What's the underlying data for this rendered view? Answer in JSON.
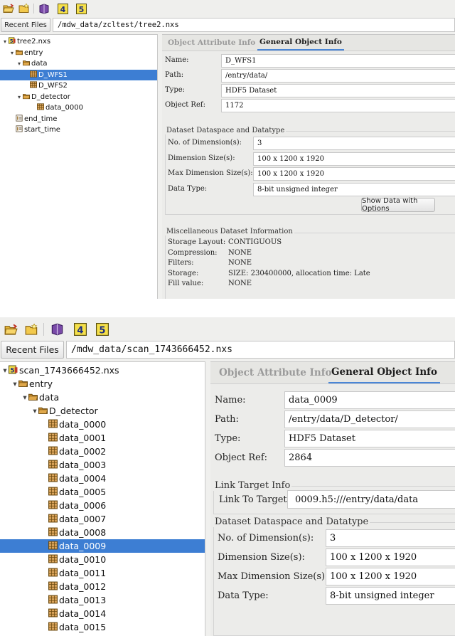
{
  "top": {
    "recent_files_label": "Recent Files",
    "path": "/mdw_data/zcltest/tree2.nxs",
    "tree": [
      {
        "label": "tree2.nxs",
        "level": 0,
        "kind": "file",
        "open": true
      },
      {
        "label": "entry",
        "level": 1,
        "kind": "group",
        "open": true
      },
      {
        "label": "data",
        "level": 2,
        "kind": "group",
        "open": true
      },
      {
        "label": "D_WFS1",
        "level": 3,
        "kind": "dataset",
        "selected": true
      },
      {
        "label": "D_WFS2",
        "level": 3,
        "kind": "dataset"
      },
      {
        "label": "D_detector",
        "level": 2,
        "kind": "group",
        "open": true
      },
      {
        "label": "data_0000",
        "level": 4,
        "kind": "dataset"
      },
      {
        "label": "end_time",
        "level": 1,
        "kind": "scalar"
      },
      {
        "label": "start_time",
        "level": 1,
        "kind": "scalar"
      }
    ],
    "tabs": [
      "Object Attribute Info",
      "General Object Info"
    ],
    "fields": [
      {
        "label": "Name:",
        "value": "D_WFS1"
      },
      {
        "label": "Path:",
        "value": "/entry/data/"
      },
      {
        "label": "Type:",
        "value": "HDF5 Dataset"
      },
      {
        "label": "Object Ref:",
        "value": "1172"
      }
    ],
    "dataspace_title": "Dataset Dataspace and Datatype",
    "dataspace": [
      {
        "label": "No. of Dimension(s):",
        "value": "3"
      },
      {
        "label": "Dimension Size(s):",
        "value": "100 x 1200 x 1920"
      },
      {
        "label": "Max Dimension Size(s):",
        "value": "100 x 1200 x 1920"
      },
      {
        "label": "Data Type:",
        "value": "8-bit unsigned integer"
      }
    ],
    "show_data_button": "Show Data with Options",
    "misc_title": "Miscellaneous Dataset Information",
    "misc": [
      {
        "label": "Storage Layout:",
        "value": "CONTIGUOUS"
      },
      {
        "label": "Compression:",
        "value": "NONE"
      },
      {
        "label": "Filters:",
        "value": "NONE"
      },
      {
        "label": "Storage:",
        "value": "SIZE: 230400000, allocation time: Late"
      },
      {
        "label": "Fill value:",
        "value": "NONE"
      }
    ]
  },
  "bottom": {
    "recent_files_label": "Recent Files",
    "path": "/mdw_data/scan_1743666452.nxs",
    "tree": [
      {
        "label": "scan_1743666452.nxs",
        "level": 0,
        "kind": "file",
        "open": true
      },
      {
        "label": "entry",
        "level": 1,
        "kind": "group",
        "open": true
      },
      {
        "label": "data",
        "level": 2,
        "kind": "group",
        "open": true
      },
      {
        "label": "D_detector",
        "level": 3,
        "kind": "group",
        "open": true
      },
      {
        "label": "data_0000",
        "level": 4,
        "kind": "dataset"
      },
      {
        "label": "data_0001",
        "level": 4,
        "kind": "dataset"
      },
      {
        "label": "data_0002",
        "level": 4,
        "kind": "dataset"
      },
      {
        "label": "data_0003",
        "level": 4,
        "kind": "dataset"
      },
      {
        "label": "data_0004",
        "level": 4,
        "kind": "dataset"
      },
      {
        "label": "data_0005",
        "level": 4,
        "kind": "dataset"
      },
      {
        "label": "data_0006",
        "level": 4,
        "kind": "dataset"
      },
      {
        "label": "data_0007",
        "level": 4,
        "kind": "dataset"
      },
      {
        "label": "data_0008",
        "level": 4,
        "kind": "dataset"
      },
      {
        "label": "data_0009",
        "level": 4,
        "kind": "dataset",
        "selected": true
      },
      {
        "label": "data_0010",
        "level": 4,
        "kind": "dataset"
      },
      {
        "label": "data_0011",
        "level": 4,
        "kind": "dataset"
      },
      {
        "label": "data_0012",
        "level": 4,
        "kind": "dataset"
      },
      {
        "label": "data_0013",
        "level": 4,
        "kind": "dataset"
      },
      {
        "label": "data_0014",
        "level": 4,
        "kind": "dataset"
      },
      {
        "label": "data_0015",
        "level": 4,
        "kind": "dataset"
      }
    ],
    "tabs": [
      "Object Attribute Info",
      "General Object Info"
    ],
    "fields": [
      {
        "label": "Name:",
        "value": "data_0009"
      },
      {
        "label": "Path:",
        "value": "/entry/data/D_detector/"
      },
      {
        "label": "Type:",
        "value": "HDF5 Dataset"
      },
      {
        "label": "Object Ref:",
        "value": "2864"
      }
    ],
    "link_title": "Link Target Info",
    "link": {
      "label": "Link To Target:",
      "value": "0009.h5:///entry/data/data"
    },
    "dataspace_title": "Dataset Dataspace and Datatype",
    "dataspace": [
      {
        "label": "No. of Dimension(s):",
        "value": "3"
      },
      {
        "label": "Dimension Size(s):",
        "value": "100 x 1200 x 1920"
      },
      {
        "label": "Max Dimension Size(s):",
        "value": "100 x 1200 x 1920"
      },
      {
        "label": "Data Type:",
        "value": "8-bit unsigned integer"
      }
    ]
  },
  "toolbar_icons": [
    "open-folder-icon",
    "new-folder-icon",
    "book-icon",
    "hdf4-icon",
    "hdf5-icon"
  ]
}
